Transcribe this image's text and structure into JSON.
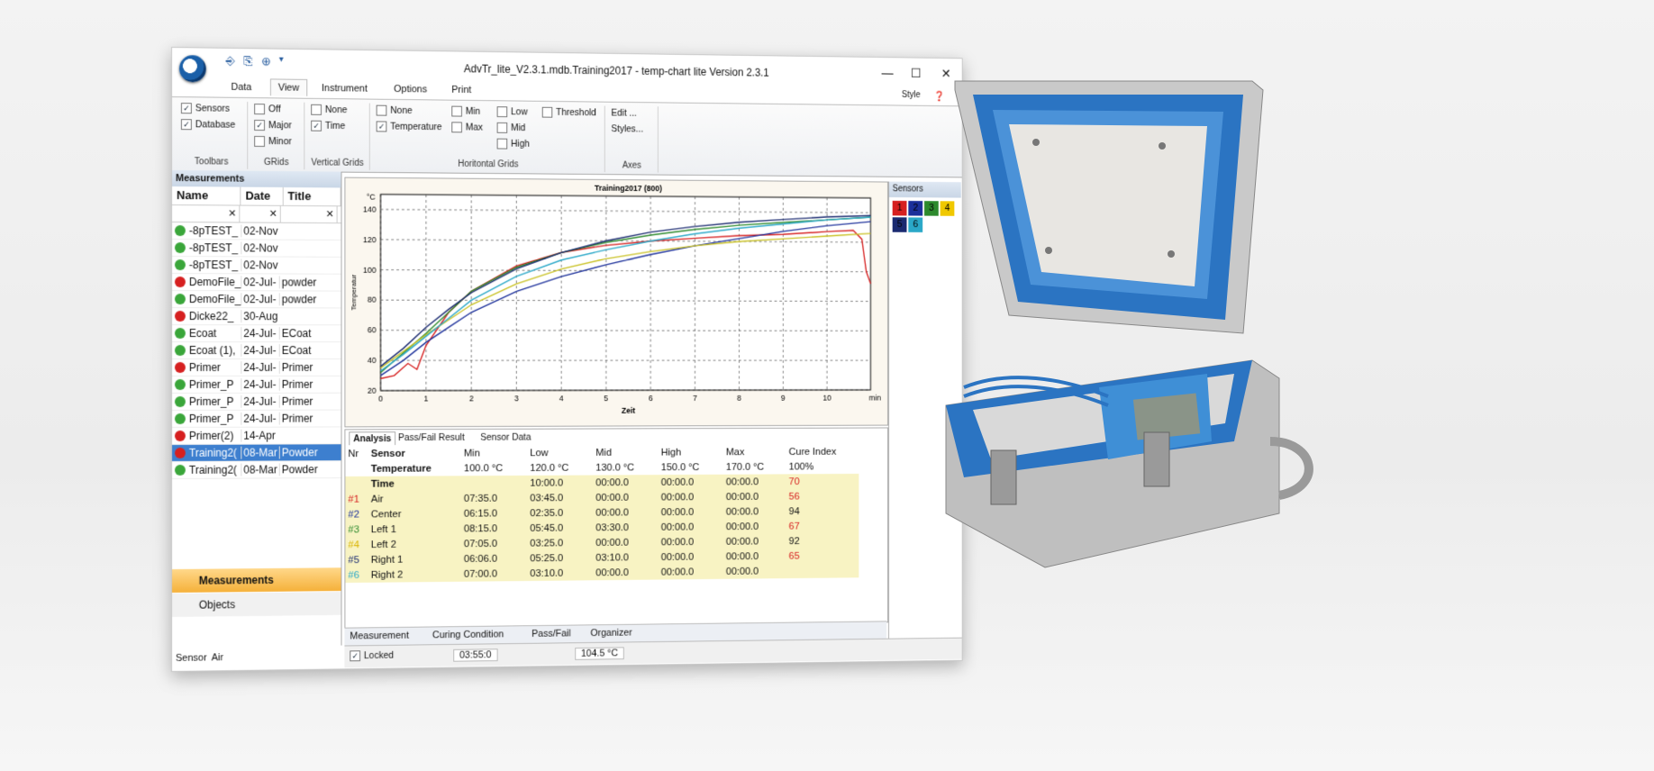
{
  "window": {
    "title": "AdvTr_lite_V2.3.1.mdb.Training2017 - temp-chart lite Version 2.3.1"
  },
  "ribbon": {
    "tabs": [
      "Data",
      "View",
      "Instrument",
      "Options",
      "Print"
    ],
    "style_label": "Style",
    "toolbars": {
      "sensors": "Sensors",
      "database": "Database",
      "label": "Toolbars"
    },
    "grids": {
      "off": "Off",
      "major": "Major",
      "minor": "Minor",
      "label": "GRids"
    },
    "vgrids": {
      "none": "None",
      "time": "Time",
      "label": "Vertical Grids"
    },
    "hgrids": {
      "none": "None",
      "temperature": "Temperature",
      "min": "Min",
      "max": "Max",
      "low": "Low",
      "mid": "Mid",
      "high": "High",
      "threshold": "Threshold",
      "label": "Horitontal Grids"
    },
    "axes": {
      "edit": "Edit ...",
      "styles": "Styles...",
      "label": "Axes"
    }
  },
  "measurements": {
    "header": "Measurements",
    "columns": [
      "Name",
      "Date",
      "Title"
    ],
    "rows": [
      {
        "name": "-8pTEST_",
        "date": "02-Nov",
        "title": "",
        "color": "#3aa63a"
      },
      {
        "name": "-8pTEST_",
        "date": "02-Nov",
        "title": "",
        "color": "#3aa63a"
      },
      {
        "name": "-8pTEST_",
        "date": "02-Nov",
        "title": "",
        "color": "#3aa63a"
      },
      {
        "name": "DemoFile_",
        "date": "02-Jul-",
        "title": "powder",
        "color": "#d62020"
      },
      {
        "name": "DemoFile_",
        "date": "02-Jul-",
        "title": "powder",
        "color": "#3aa63a"
      },
      {
        "name": "Dicke22_",
        "date": "30-Aug",
        "title": "",
        "color": "#d62020"
      },
      {
        "name": "Ecoat",
        "date": "24-Jul-",
        "title": "ECoat",
        "color": "#3aa63a"
      },
      {
        "name": "Ecoat (1),",
        "date": "24-Jul-",
        "title": "ECoat",
        "color": "#3aa63a"
      },
      {
        "name": "Primer",
        "date": "24-Jul-",
        "title": "Primer",
        "color": "#d62020"
      },
      {
        "name": "Primer_P",
        "date": "24-Jul-",
        "title": "Primer",
        "color": "#3aa63a"
      },
      {
        "name": "Primer_P",
        "date": "24-Jul-",
        "title": "Primer",
        "color": "#3aa63a"
      },
      {
        "name": "Primer_P",
        "date": "24-Jul-",
        "title": "Primer",
        "color": "#3aa63a"
      },
      {
        "name": "Primer(2)",
        "date": "14-Apr",
        "title": "",
        "color": "#d62020"
      },
      {
        "name": "Training2(",
        "date": "08-Mar",
        "title": "Powder",
        "color": "#d62020",
        "selected": true
      },
      {
        "name": "Training2(",
        "date": "08-Mar",
        "title": "Powder",
        "color": "#3aa63a"
      }
    ],
    "nav": [
      "Measurements",
      "Objects"
    ],
    "sensor_label": "Sensor",
    "sensor_value": "Air"
  },
  "chart_data": {
    "type": "line",
    "title": "Training2017 (800)",
    "xlabel": "Zeit",
    "ylabel": "Temperatur",
    "yunit": "°C",
    "xunit": "min",
    "xlim": [
      0,
      11
    ],
    "ylim": [
      20,
      150
    ],
    "xticks": [
      0,
      1,
      2,
      3,
      4,
      5,
      6,
      7,
      8,
      9,
      10
    ],
    "yticks": [
      20,
      40,
      60,
      80,
      100,
      120,
      140
    ],
    "grid": true,
    "series": [
      {
        "color": "#d62020",
        "x": [
          0,
          0.3,
          0.6,
          0.8,
          1.0,
          1.5,
          2,
          3,
          4,
          5,
          6,
          7,
          8,
          9,
          10,
          10.6,
          10.8,
          10.9,
          11
        ],
        "y": [
          28,
          30,
          38,
          34,
          50,
          72,
          86,
          103,
          112,
          117,
          120,
          122,
          124,
          125,
          127,
          128,
          122,
          100,
          92
        ]
      },
      {
        "color": "#1b2f9a",
        "x": [
          0,
          0.5,
          1,
          1.5,
          2,
          3,
          4,
          5,
          6,
          7,
          8,
          9,
          10,
          11
        ],
        "y": [
          30,
          40,
          52,
          62,
          72,
          86,
          96,
          104,
          111,
          117,
          122,
          127,
          131,
          134
        ]
      },
      {
        "color": "#2d8a2d",
        "x": [
          0,
          0.5,
          1,
          1.5,
          2,
          3,
          4,
          5,
          6,
          7,
          8,
          9,
          10,
          11
        ],
        "y": [
          32,
          45,
          58,
          72,
          86,
          102,
          112,
          119,
          124,
          128,
          131,
          133,
          135,
          137
        ]
      },
      {
        "color": "#c8c020",
        "x": [
          0,
          0.5,
          1,
          1.5,
          2,
          3,
          4,
          5,
          6,
          7,
          8,
          9,
          10,
          11
        ],
        "y": [
          35,
          46,
          57,
          67,
          77,
          91,
          101,
          108,
          113,
          117,
          120,
          122,
          124,
          126
        ]
      },
      {
        "color": "#1a2a70",
        "x": [
          0,
          0.5,
          1,
          1.5,
          2,
          3,
          4,
          5,
          6,
          7,
          8,
          9,
          10,
          11
        ],
        "y": [
          36,
          48,
          62,
          74,
          85,
          101,
          112,
          120,
          126,
          130,
          133,
          135,
          137,
          138
        ]
      },
      {
        "color": "#2aa8c8",
        "x": [
          0,
          0.5,
          1,
          1.5,
          2,
          3,
          4,
          5,
          6,
          7,
          8,
          9,
          10,
          11
        ],
        "y": [
          33,
          44,
          56,
          68,
          80,
          96,
          107,
          114,
          120,
          125,
          129,
          132,
          135,
          137
        ]
      }
    ]
  },
  "analysis": {
    "tabs": [
      "Analysis",
      "Pass/Fail Result",
      "Sensor Data"
    ],
    "headers": {
      "nr": "Nr",
      "sensor": "Sensor",
      "min": "Min",
      "low": "Low",
      "mid": "Mid",
      "high": "High",
      "max": "Max",
      "cure": "Cure Index"
    },
    "temp_label": "Temperature",
    "time_label": "Time",
    "temp_row": {
      "min": "100.0 °C",
      "low": "120.0 °C",
      "mid": "130.0 °C",
      "high": "150.0 °C",
      "max": "170.0 °C",
      "cure": "100%"
    },
    "time_row": {
      "low": "10:00.0",
      "mid": "00:00.0",
      "high": "00:00.0"
    },
    "max_sub": "00:00.0",
    "cure_sub": "70",
    "rows": [
      {
        "nr": "#1",
        "nr_color": "#d62020",
        "sensor": "Air",
        "min": "07:35.0",
        "low": "03:45.0",
        "mid": "00:00.0",
        "high": "00:00.0",
        "max": "00:00.0",
        "cure": "56",
        "cure_color": "#d62020"
      },
      {
        "nr": "#2",
        "nr_color": "#1b2f9a",
        "sensor": "Center",
        "min": "06:15.0",
        "low": "02:35.0",
        "mid": "00:00.0",
        "high": "00:00.0",
        "max": "00:00.0",
        "cure": "94",
        "cure_color": "#111"
      },
      {
        "nr": "#3",
        "nr_color": "#2d8a2d",
        "sensor": "Left 1",
        "min": "08:15.0",
        "low": "05:45.0",
        "mid": "03:30.0",
        "high": "00:00.0",
        "max": "00:00.0",
        "cure": "67",
        "cure_color": "#d62020"
      },
      {
        "nr": "#4",
        "nr_color": "#d9b400",
        "sensor": "Left 2",
        "min": "07:05.0",
        "low": "03:25.0",
        "mid": "00:00.0",
        "high": "00:00.0",
        "max": "00:00.0",
        "cure": "92",
        "cure_color": "#111"
      },
      {
        "nr": "#5",
        "nr_color": "#1a2a70",
        "sensor": "Right 1",
        "min": "06:06.0",
        "low": "05:25.0",
        "mid": "03:10.0",
        "high": "00:00.0",
        "max": "00:00.0",
        "cure": "65",
        "cure_color": "#d62020"
      },
      {
        "nr": "#6",
        "nr_color": "#2aa8c8",
        "sensor": "Right 2",
        "min": "07:00.0",
        "low": "03:10.0",
        "mid": "00:00.0",
        "high": "00:00.0",
        "max": "00:00.0",
        "cure": "",
        "cure_color": "#111"
      }
    ],
    "bottom_tabs": [
      "Measurement",
      "Curing Condition",
      "Pass/Fail",
      "Organizer"
    ]
  },
  "sensors_panel": {
    "title": "Sensors",
    "items": [
      {
        "label": "1",
        "color": "#d62020"
      },
      {
        "label": "2",
        "color": "#1b2f9a"
      },
      {
        "label": "3",
        "color": "#2d8a2d"
      },
      {
        "label": "4",
        "color": "#f0c800"
      },
      {
        "label": "5",
        "color": "#1a2a70"
      },
      {
        "label": "6",
        "color": "#2aa8c8"
      }
    ]
  },
  "status": {
    "locked_label": "Locked",
    "time_value": "03:55:0",
    "temp_value": "104.5 °C"
  }
}
